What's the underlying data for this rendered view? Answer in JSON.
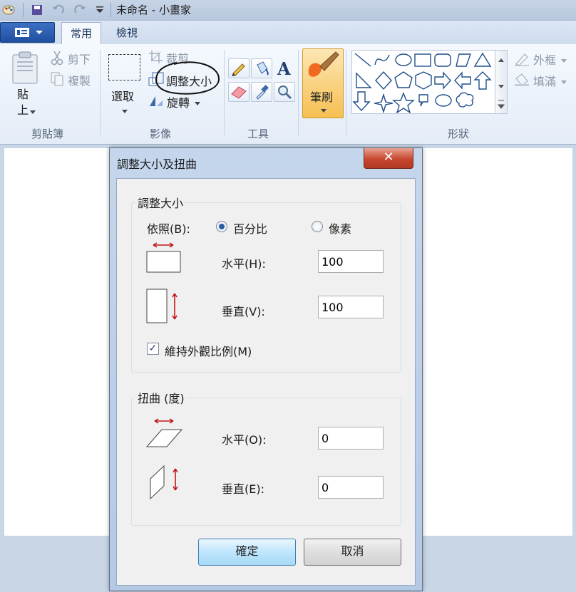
{
  "window": {
    "title": "未命名 - 小畫家"
  },
  "tabs": [
    {
      "label": "常用",
      "active": true
    },
    {
      "label": "檢視",
      "active": false
    }
  ],
  "ribbon": {
    "clipboard": {
      "group_label": "剪貼簿",
      "paste_label": "貼上",
      "cut_label": "剪下",
      "copy_label": "複製"
    },
    "image": {
      "group_label": "影像",
      "select_label": "選取",
      "crop_label": "裁剪",
      "resize_label": "調整大小",
      "rotate_label": "旋轉"
    },
    "tools": {
      "group_label": "工具"
    },
    "brushes": {
      "label": "筆刷"
    },
    "shapes": {
      "group_label": "形狀",
      "outline_label": "外框",
      "fill_label": "填滿"
    }
  },
  "dialog": {
    "title": "調整大小及扭曲",
    "close_glyph": "✕",
    "resize": {
      "group_label": "調整大小",
      "by_label": "依照(B):",
      "percent_label": "百分比",
      "pixels_label": "像素",
      "selected": "percent",
      "horizontal_label": "水平(H):",
      "horizontal_value": "100",
      "vertical_label": "垂直(V):",
      "vertical_value": "100",
      "keep_ratio_label": "維持外觀比例(M)",
      "keep_ratio_checked": true
    },
    "skew": {
      "group_label": "扭曲 (度)",
      "horizontal_label": "水平(O):",
      "horizontal_value": "0",
      "vertical_label": "垂直(E):",
      "vertical_value": "0"
    },
    "ok_label": "確定",
    "cancel_label": "取消"
  },
  "colors": {
    "accent": "#2a5ea8",
    "arrow_red": "#c0181b",
    "brush_orange": "#f5b14a"
  }
}
